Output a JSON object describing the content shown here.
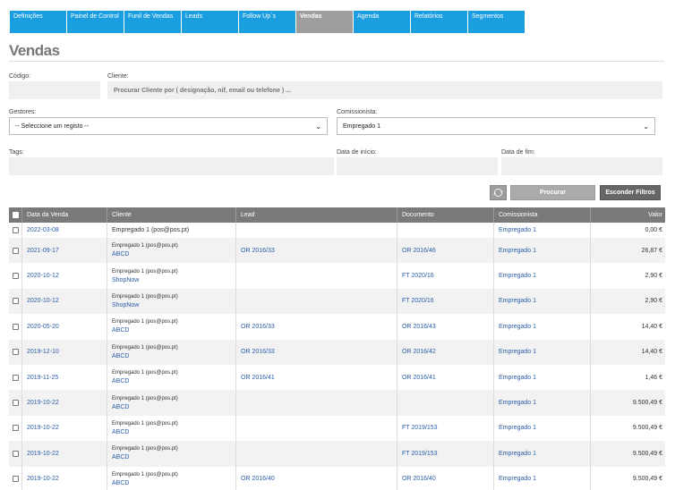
{
  "nav": {
    "tabs": [
      {
        "label": "Definições"
      },
      {
        "label": "Painel de Control"
      },
      {
        "label": "Funil de Vendas"
      },
      {
        "label": "Leads"
      },
      {
        "label": "Follow Up´s"
      },
      {
        "label": "Vendas",
        "active": true
      },
      {
        "label": "Agenda"
      },
      {
        "label": "Relatórios"
      },
      {
        "label": "Segmentos"
      }
    ]
  },
  "page": {
    "title": "Vendas"
  },
  "filters": {
    "codigo_label": "Código:",
    "cliente_label": "Cliente:",
    "cliente_placeholder": "Procurar Cliente por ( designação, nif, email ou telefone ) ...",
    "gestores_label": "Gestores:",
    "gestores_value": "-- Seleccione um registo --",
    "comissionista_label": "Comissionista:",
    "comissionista_value": "Empregado 1",
    "tags_label": "Tags:",
    "data_inicio_label": "Data de início:",
    "data_fim_label": "Data de fim:",
    "search_button": "Procurar",
    "hide_filters_button": "Esconder Filtros"
  },
  "table": {
    "headers": [
      "Data da Venda",
      "Cliente",
      "Lead",
      "Documento",
      "Comissionista",
      "Valor"
    ],
    "rows": [
      {
        "date": "2022-03-08",
        "client_sub": "Empregado 1 (pos@pos.pt)",
        "client": "",
        "lead": "",
        "doc": "",
        "comm": "Empregado 1",
        "value": "0,00 €"
      },
      {
        "date": "2021-09-17",
        "client_sub": "Empregado 1 (pos@pos.pt)",
        "client": "ABCD",
        "lead": "OR 2016/33",
        "doc": "OR 2016/46",
        "comm": "Empregado 1",
        "value": "26,87 €"
      },
      {
        "date": "2020-10-12",
        "client_sub": "Empregado 1 (pos@pos.pt)",
        "client": "ShopNow",
        "lead": "",
        "doc": "FT 2020/16",
        "comm": "Empregado 1",
        "value": "2,90 €"
      },
      {
        "date": "2020-10-12",
        "client_sub": "Empregado 1 (pos@pos.pt)",
        "client": "ShopNow",
        "lead": "",
        "doc": "FT 2020/16",
        "comm": "Empregado 1",
        "value": "2,90 €"
      },
      {
        "date": "2020-05-20",
        "client_sub": "Empregado 1 (pos@pos.pt)",
        "client": "ABCD",
        "lead": "OR 2016/33",
        "doc": "OR 2016/43",
        "comm": "Empregado 1",
        "value": "14,40 €"
      },
      {
        "date": "2019-12-10",
        "client_sub": "Empregado 1 (pos@pos.pt)",
        "client": "ABCD",
        "lead": "OR 2016/33",
        "doc": "OR 2016/42",
        "comm": "Empregado 1",
        "value": "14,40 €"
      },
      {
        "date": "2019-11-25",
        "client_sub": "Empregado 1 (pos@pos.pt)",
        "client": "ABCD",
        "lead": "OR 2016/41",
        "doc": "OR 2016/41",
        "comm": "Empregado 1",
        "value": "1,46 €"
      },
      {
        "date": "2019-10-22",
        "client_sub": "Empregado 1 (pos@pos.pt)",
        "client": "ABCD",
        "lead": "",
        "doc": "",
        "comm": "Empregado 1",
        "value": "9.500,49 €"
      },
      {
        "date": "2019-10-22",
        "client_sub": "Empregado 1 (pos@pos.pt)",
        "client": "ABCD",
        "lead": "",
        "doc": "FT 2019/153",
        "comm": "Empregado 1",
        "value": "9.500,49 €"
      },
      {
        "date": "2019-10-22",
        "client_sub": "Empregado 1 (pos@pos.pt)",
        "client": "ABCD",
        "lead": "",
        "doc": "FT 2019/153",
        "comm": "Empregado 1",
        "value": "9.500,49 €"
      },
      {
        "date": "2019-10-22",
        "client_sub": "Empregado 1 (pos@pos.pt)",
        "client": "ABCD",
        "lead": "OR 2016/40",
        "doc": "OR 2016/40",
        "comm": "Empregado 1",
        "value": "9.500,49 €"
      }
    ]
  }
}
